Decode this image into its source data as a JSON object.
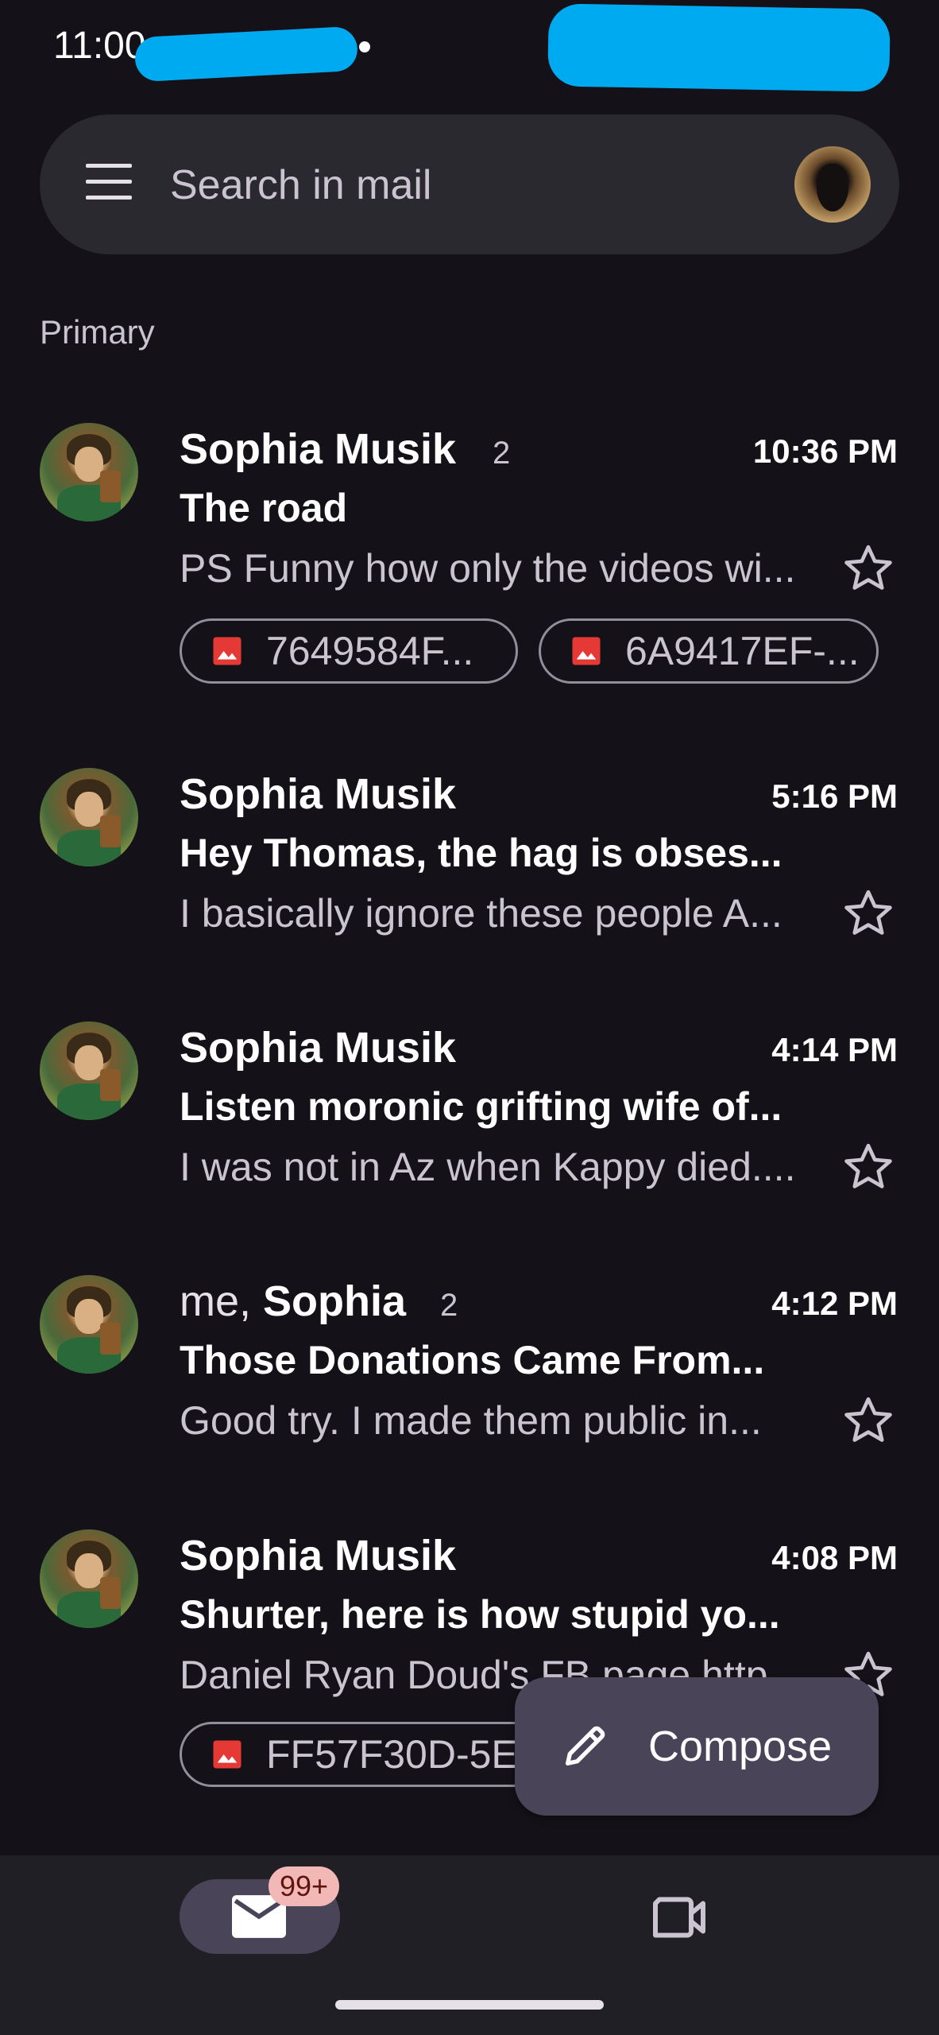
{
  "status_bar": {
    "time": "11:00"
  },
  "search": {
    "placeholder": "Search in mail"
  },
  "section_label": "Primary",
  "emails": [
    {
      "sender": "Sophia Musik",
      "count": "2",
      "time": "10:36 PM",
      "subject": "The road",
      "snippet": "PS Funny how only the videos wi...",
      "attachments": [
        "7649584F...",
        "6A9417EF-..."
      ]
    },
    {
      "sender": "Sophia Musik",
      "count": "",
      "time": "5:16 PM",
      "subject": "Hey Thomas, the hag is obses...",
      "snippet": "I basically ignore these people A...",
      "attachments": []
    },
    {
      "sender": "Sophia Musik",
      "count": "",
      "time": "4:14 PM",
      "subject": "Listen moronic grifting wife of...",
      "snippet": "I was not in Az when Kappy died....",
      "attachments": []
    },
    {
      "sender_prefix": "me, ",
      "sender": "Sophia",
      "count": "2",
      "time": "4:12 PM",
      "subject": "Those Donations Came From...",
      "snippet": "Good try. I made them public in...",
      "attachments": []
    },
    {
      "sender": "Sophia Musik",
      "count": "",
      "time": "4:08 PM",
      "subject": "Shurter, here is how stupid yo...",
      "snippet": "Daniel Ryan Doud's FB page http...",
      "attachments": [
        "FF57F30D-5E..."
      ]
    }
  ],
  "compose": {
    "label": "Compose"
  },
  "bottom_nav": {
    "mail_badge": "99+"
  },
  "icons": {
    "menu": "menu-icon",
    "star": "star-outline-icon",
    "attachment": "image-icon",
    "compose": "pencil-icon",
    "mail": "mail-icon",
    "meet": "video-camera-icon"
  },
  "colors": {
    "background": "#141218",
    "search_bar": "#2b2930",
    "fab": "#4a4458",
    "attachment_red": "#e53935",
    "badge": "#f2b8b5",
    "redaction": "#00aaf0"
  }
}
